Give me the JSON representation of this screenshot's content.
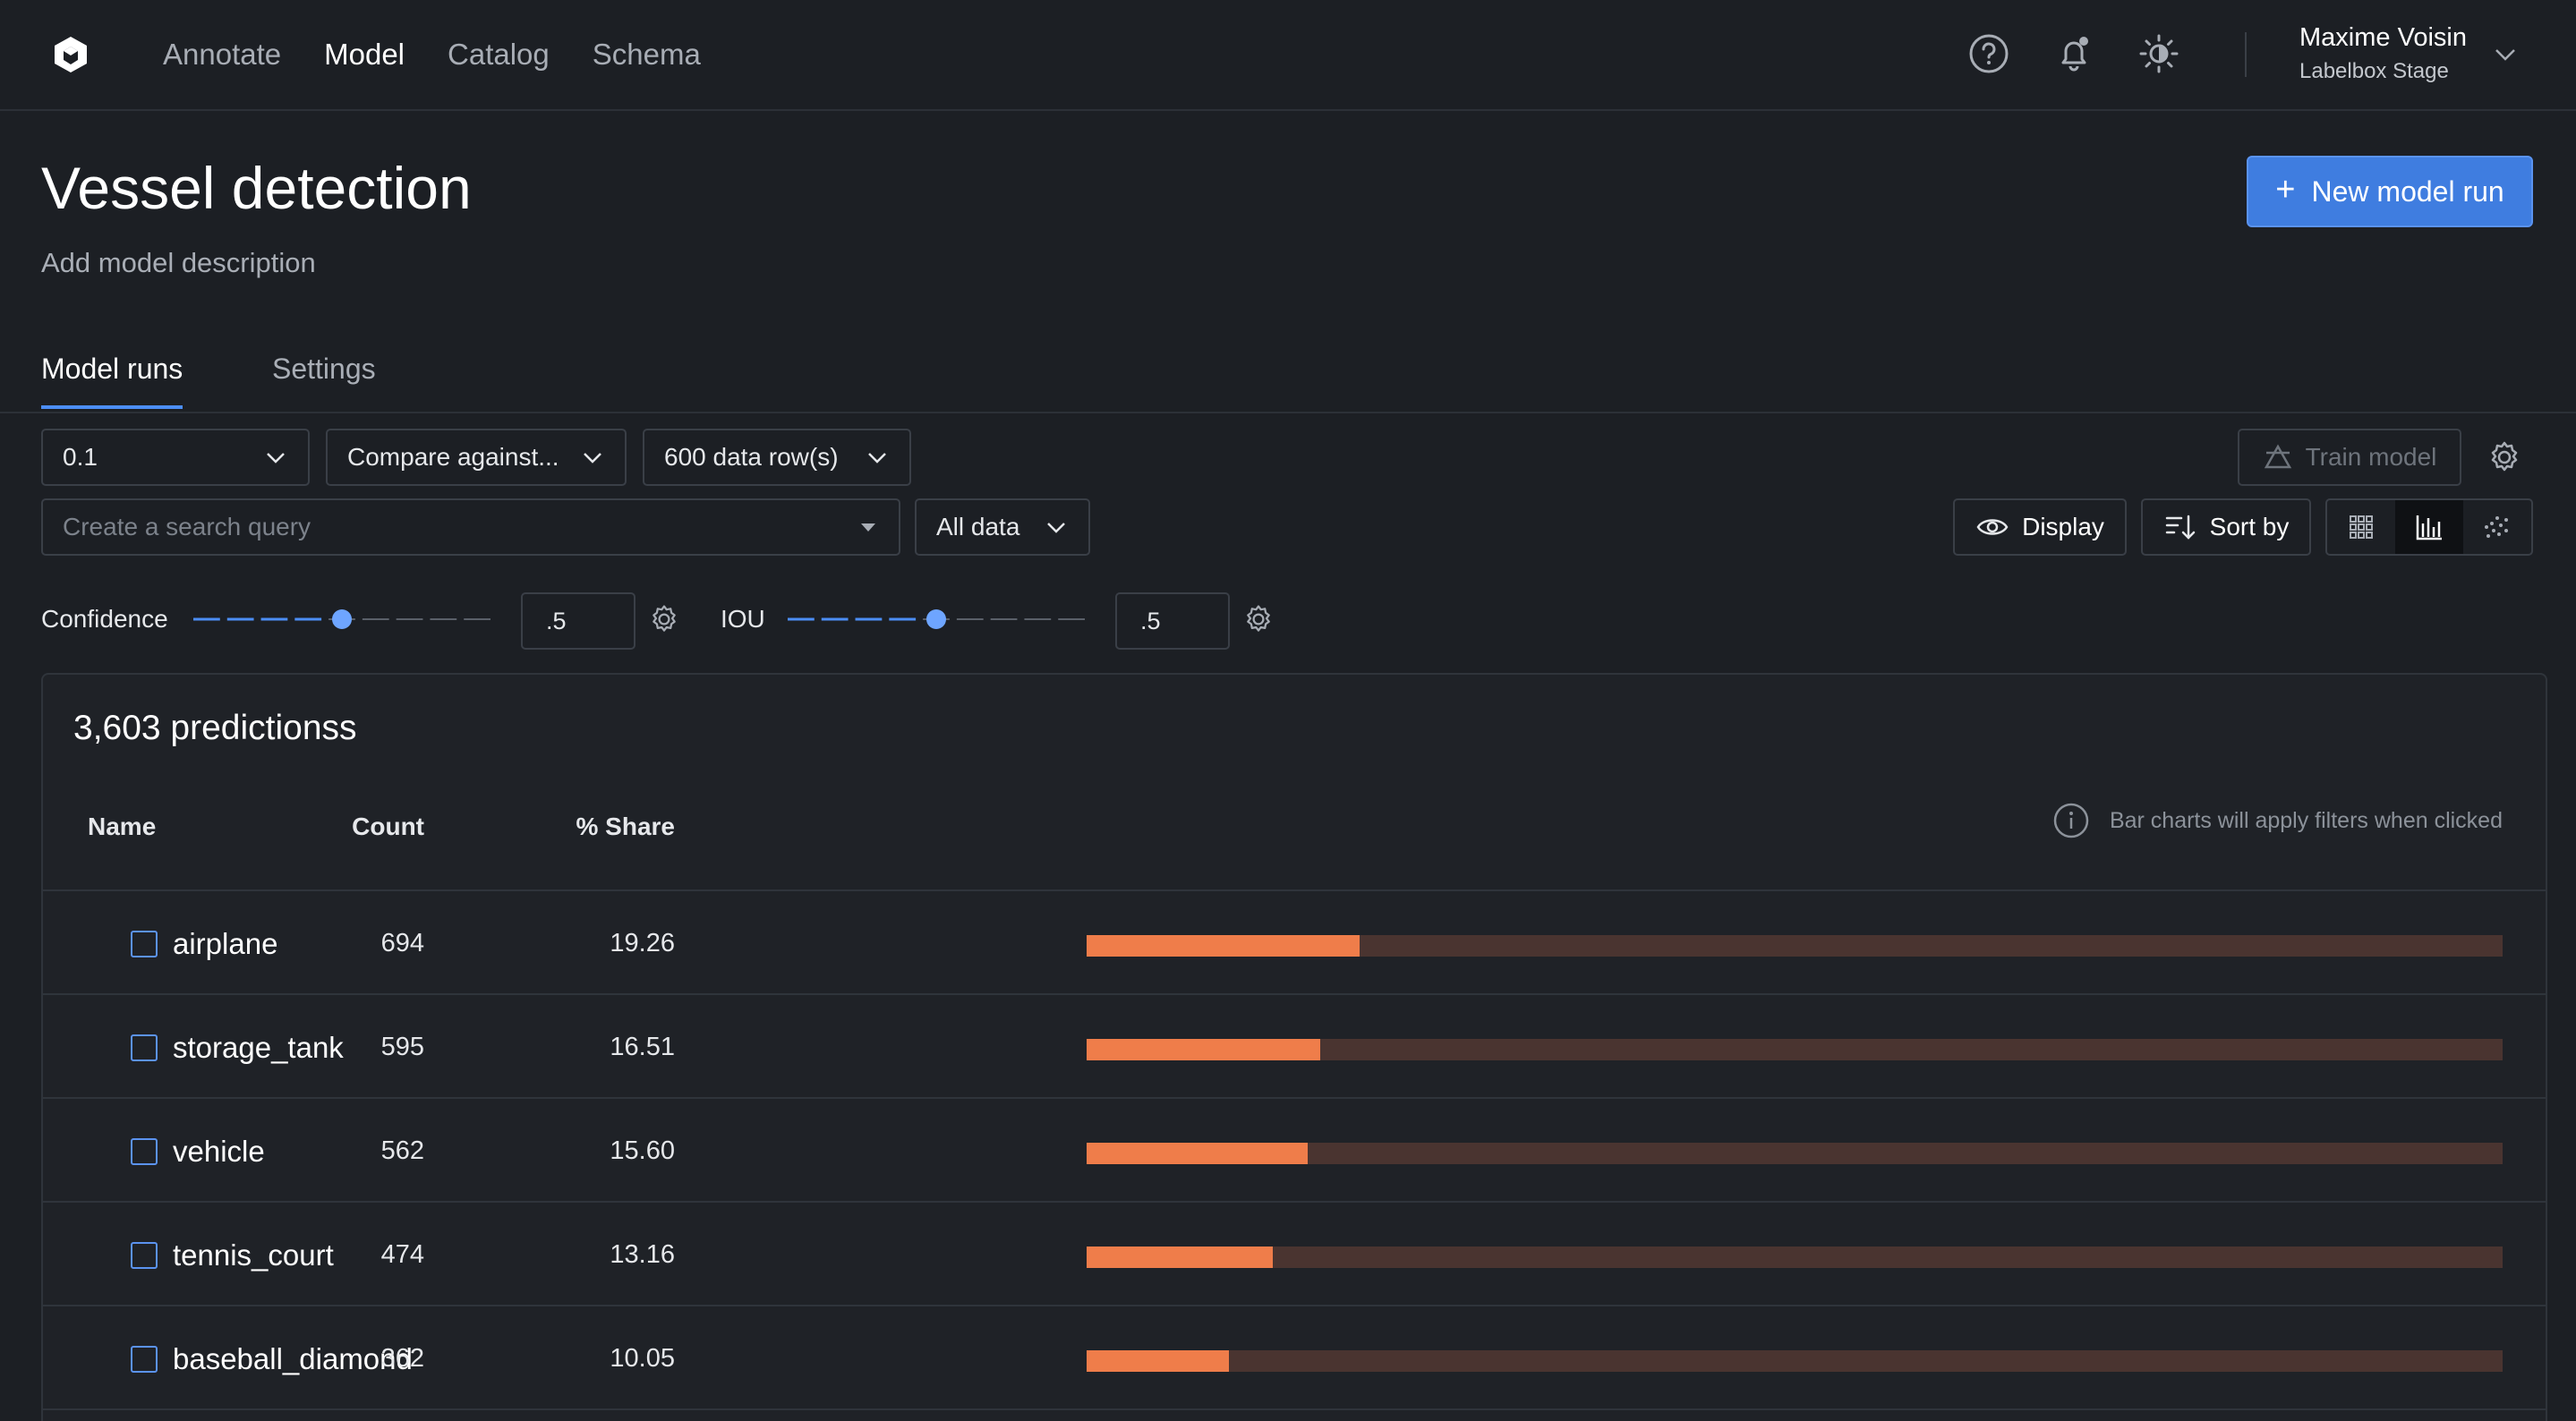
{
  "nav": {
    "links": [
      "Annotate",
      "Model",
      "Catalog",
      "Schema"
    ],
    "active_link": "Model",
    "user_name": "Maxime Voisin",
    "user_org": "Labelbox Stage",
    "icons": [
      "help-icon",
      "notification-bell-icon",
      "theme-toggle-icon"
    ]
  },
  "header": {
    "title": "Vessel detection",
    "description": "Add model description",
    "new_run_label": "New model run"
  },
  "tabs": [
    {
      "label": "Model runs",
      "active": true
    },
    {
      "label": "Settings",
      "active": false
    }
  ],
  "toolbar": {
    "version": "0.1",
    "compare": "Compare against...",
    "data_rows": "600 data row(s)",
    "train_label": "Train model",
    "search_placeholder": "Create a search query",
    "filter": "All data",
    "display_label": "Display",
    "sort_label": "Sort by",
    "view_modes": [
      "grid-view-icon",
      "chart-view-icon",
      "scatter-view-icon"
    ],
    "active_view": "chart-view-icon"
  },
  "sliders": {
    "confidence": {
      "label": "Confidence",
      "value": ".5",
      "level": 0.5
    },
    "iou": {
      "label": "IOU",
      "value": ".5",
      "level": 0.5
    }
  },
  "predictions": {
    "title": "3,603 predictionss",
    "columns": {
      "name": "Name",
      "count": "Count",
      "share": "% Share"
    },
    "hint": "Bar charts will apply filters when clicked",
    "rows": [
      {
        "name": "airplane",
        "count": "694",
        "share": "19.26",
        "share_value": 19.26
      },
      {
        "name": "storage_tank",
        "count": "595",
        "share": "16.51",
        "share_value": 16.51
      },
      {
        "name": "vehicle",
        "count": "562",
        "share": "15.60",
        "share_value": 15.6
      },
      {
        "name": "tennis_court",
        "count": "474",
        "share": "13.16",
        "share_value": 13.16
      },
      {
        "name": "baseball_diamond",
        "count": "362",
        "share": "10.05",
        "share_value": 10.05
      }
    ]
  },
  "colors": {
    "accent": "#3f7de0",
    "bar_fill": "#ef7d4a",
    "bar_track": "#4a3430",
    "background": "#1c1f24"
  }
}
